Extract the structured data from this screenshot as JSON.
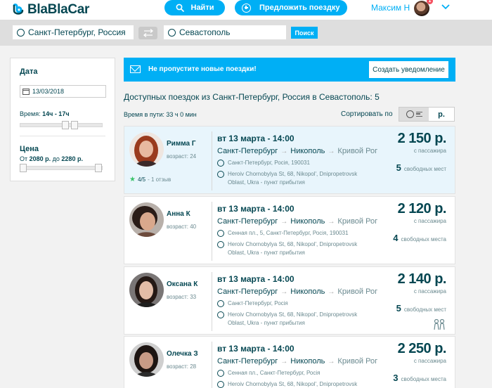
{
  "header": {
    "logo": "BlaBlaCar",
    "find_label": "Найти",
    "offer_label": "Предложить поездку",
    "user_name": "Максим Н",
    "notifications": "1"
  },
  "search": {
    "from": "Санкт-Петербург, Россия",
    "to": "Севастополь",
    "button": "Поиск"
  },
  "filters": {
    "date_title": "Дата",
    "date_value": "13/03/2018",
    "time_label_prefix": "Время: ",
    "time_value": "14ч - 17ч",
    "price_title": "Цена",
    "price_prefix": "От ",
    "price_min": "2080 р.",
    "price_mid": " до ",
    "price_max": "2280 р."
  },
  "alert": {
    "text": "Не пропустите новые поездки!",
    "button": "Создать уведомление"
  },
  "results": {
    "title": "Доступных поездок из Санкт-Петербург, Россия в Севастополь: 5",
    "travel_time": "Время в пути: 33 ч 0 мин",
    "sort_label": "Сортировать по",
    "sort_price": "р."
  },
  "trips": [
    {
      "name": "Римма Г",
      "age": "возраст: 24",
      "rating": "4/5",
      "reviews": "- 1 отзыв",
      "time": "вт 13 марта - 14:00",
      "from": "Санкт-Петербург",
      "via": "Никополь",
      "to": "Кривой Рог",
      "stop1": "Санкт-Петербург, Росія, 190031",
      "stop2": "Heroiv Chornobylya St, 68, Nikopol', Dnipropetrovsk Oblast, Ukra - пункт прибытия",
      "price": "2 150 р.",
      "price_sub": "с пассажира",
      "seats": "5",
      "seats_label": "свободных мест"
    },
    {
      "name": "Анна К",
      "age": "возраст: 40",
      "time": "вт 13 марта - 14:00",
      "from": "Санкт-Петербург",
      "via": "Никополь",
      "to": "Кривой Рог",
      "stop1": "Сенная пл., 5, Санкт-Петербург, Росія, 190031",
      "stop2": "Heroiv Chornobylya St, 68, Nikopol', Dnipropetrovsk Oblast, Ukra - пункт прибытия",
      "price": "2 120 р.",
      "price_sub": "с пассажира",
      "seats": "4",
      "seats_label": "свободных места"
    },
    {
      "name": "Оксана К",
      "age": "возраст: 33",
      "time": "вт 13 марта - 14:00",
      "from": "Санкт-Петербург",
      "via": "Никополь",
      "to": "Кривой Рог",
      "stop1": "Санкт-Петербург, Росія",
      "stop2": "Heroiv Chornobylya St, 68, Nikopol', Dnipropetrovsk Oblast, Ukra - пункт прибытия",
      "price": "2 140 р.",
      "price_sub": "с пассажира",
      "seats": "5",
      "seats_label": "свободных мест"
    },
    {
      "name": "Олечка З",
      "age": "возраст: 28",
      "time": "вт 13 марта - 14:00",
      "from": "Санкт-Петербург",
      "via": "Никополь",
      "to": "Кривой Рог",
      "stop1": "Сенная пл., Санкт-Петербург, Росія",
      "stop2": "Heroiv Chornobylya St, 68, Nikopol', Dnipropetrovsk",
      "price": "2 250 р.",
      "price_sub": "с пассажира",
      "seats": "3",
      "seats_label": "свободных места"
    }
  ],
  "colors": {
    "brand_blue": "#00aff5",
    "text_dark": "#054752",
    "rating_green": "#3ac36a",
    "highlight_bg": "#e8f5fc"
  },
  "icons": [
    "logo-icon",
    "search-icon",
    "plus-circle-icon",
    "chevron-down-icon",
    "swap-icon",
    "calendar-icon",
    "mail-icon",
    "clock-icon",
    "star-icon",
    "women-only-icon"
  ]
}
